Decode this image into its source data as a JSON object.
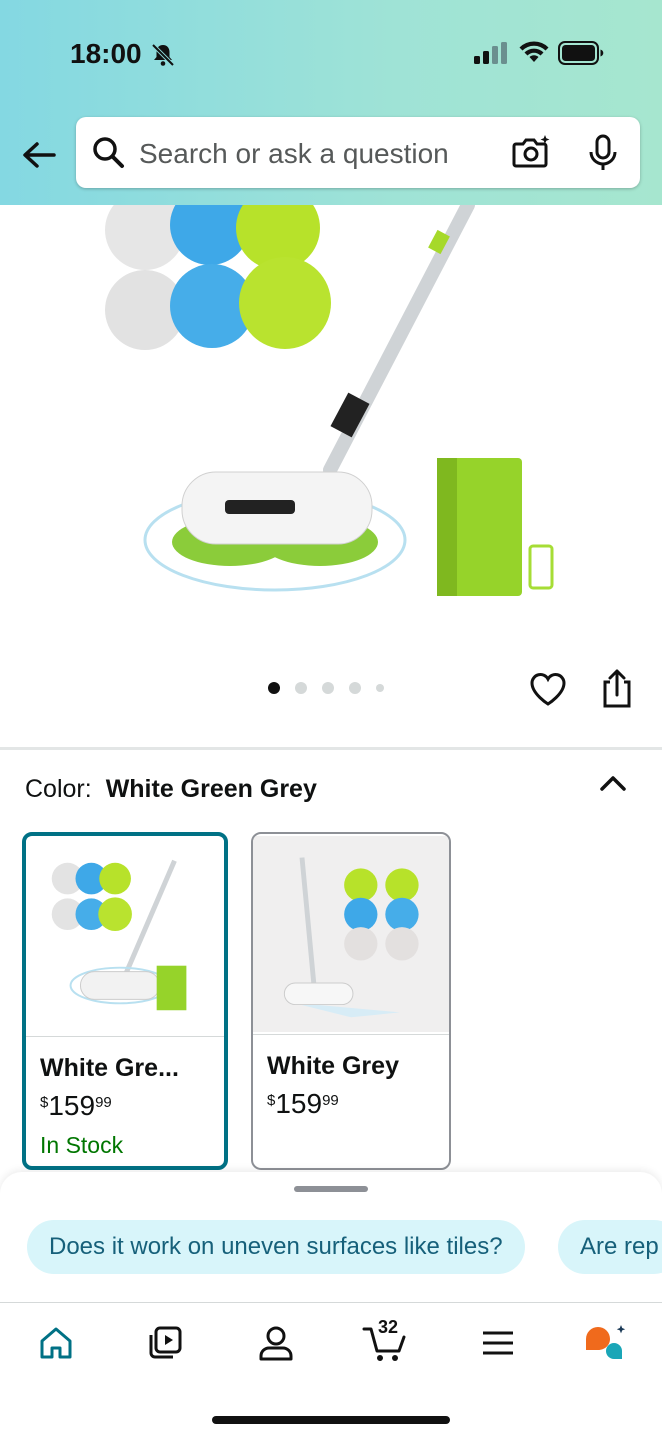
{
  "status_bar": {
    "time": "18:00"
  },
  "search": {
    "placeholder": "Search or ask a question"
  },
  "gallery": {
    "image_count": 5,
    "active_index": 0
  },
  "color": {
    "label": "Color:",
    "value": "White Green Grey"
  },
  "swatches": [
    {
      "name": "White Gre...",
      "currency": "$",
      "price_whole": "159",
      "price_fraction": "99",
      "stock": "In Stock",
      "selected": true
    },
    {
      "name": "White Grey",
      "currency": "$",
      "price_whole": "159",
      "price_fraction": "99",
      "stock": "",
      "selected": false
    }
  ],
  "suggestions": [
    "Does it work on uneven surfaces like tiles?",
    "Are rep"
  ],
  "nav": {
    "cart_count": "32",
    "items": [
      "home-icon",
      "video-icon",
      "account-icon",
      "cart-icon",
      "menu-icon",
      "ai-assistant-icon"
    ]
  },
  "colors": {
    "accent": "#007185",
    "in_stock": "#007600",
    "chip_bg": "#d8f5fa"
  }
}
